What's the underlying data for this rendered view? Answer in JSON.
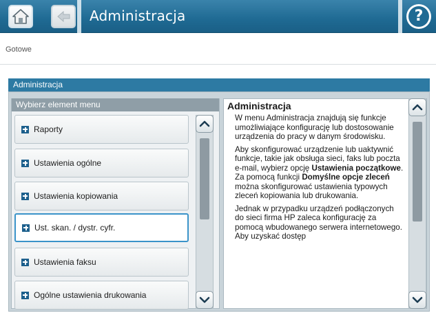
{
  "header": {
    "title": "Administracja"
  },
  "status": "Gotowe",
  "panel": {
    "title": "Administracja",
    "menu_header": "Wybierz element menu",
    "items": [
      {
        "label": "Raporty"
      },
      {
        "label": "Ustawienia ogólne"
      },
      {
        "label": "Ustawienia kopiowania"
      },
      {
        "label": "Ust. skan. / dystr. cyfr.",
        "selected": true
      },
      {
        "label": "Ustawienia faksu"
      },
      {
        "label": "Ogólne ustawienia drukowania"
      }
    ]
  },
  "help": {
    "title": "Administracja",
    "p1": "W menu Administracja znajdują się funkcje umożliwiające konfigurację lub dostosowanie urządzenia do pracy w danym środowisku.",
    "p2_a": "Aby skonfigurować urządzenie lub uaktywnić funkcje, takie jak obsługa sieci, faks lub poczta e-mail, wybierz opcję ",
    "p2_b": "Ustawienia początkowe",
    "p2_c": ". Za pomocą funkcji ",
    "p2_d": "Domyślne opcje zleceń",
    "p2_e": " można skonfigurować ustawienia typowych zleceń kopiowania lub drukowania.",
    "p3": "Jednak w przypadku urządzeń podłączonych do sieci firma HP zaleca konfigurację za pomocą wbudowanego serwera internetowego. Aby uzyskać dostęp"
  },
  "icons": {
    "home": "home-icon",
    "back": "back-icon",
    "help": "help-icon",
    "up": "chevron-up-icon",
    "down": "chevron-down-icon"
  },
  "colors": {
    "topbar": "#1f6a93",
    "accent": "#2d7aa3",
    "selected_border": "#3a93c9"
  }
}
